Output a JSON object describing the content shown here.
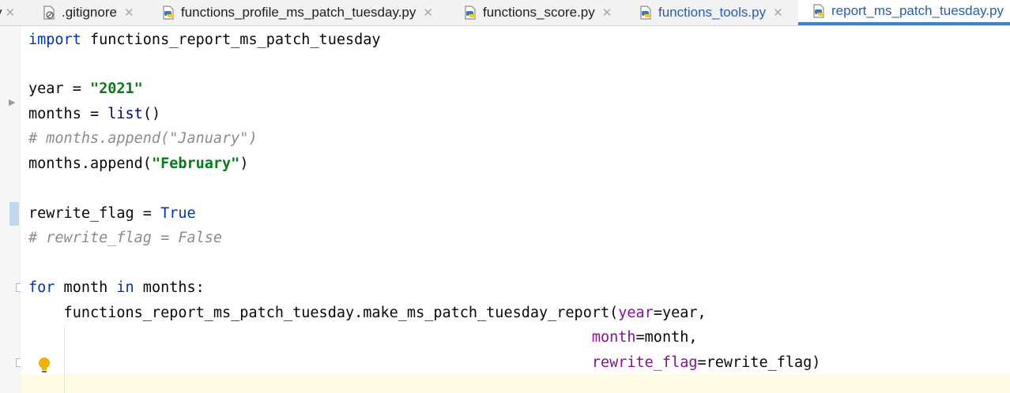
{
  "tabs": [
    {
      "label": "",
      "close": "✕",
      "icon": "python-file-icon"
    },
    {
      "label": ".gitignore",
      "close": "✕",
      "icon": "ignored-file-icon"
    },
    {
      "label": "functions_profile_ms_patch_tuesday.py",
      "close": "✕",
      "icon": "python-file-icon"
    },
    {
      "label": "functions_score.py",
      "close": "✕",
      "icon": "python-file-icon"
    },
    {
      "label": "functions_tools.py",
      "close": "✕",
      "icon": "python-file-icon"
    },
    {
      "label": "report_ms_patch_tuesday.py",
      "close": "",
      "icon": "python-file-icon",
      "active": true
    }
  ],
  "tab_first_partial": "y",
  "code": {
    "l1_kw": "import",
    "l1_rest": " functions_report_ms_patch_tuesday",
    "l3_a": "year = ",
    "l3_str": "\"2021\"",
    "l4_a": "months = ",
    "l4_fn": "list",
    "l4_b": "()",
    "l5_cmt": "# months.append(\"January\")",
    "l6_a": "months.append(",
    "l6_str": "\"February\"",
    "l6_b": ")",
    "l8_a": "rewrite_flag = ",
    "l8_kw": "True",
    "l9_cmt": "# rewrite_flag = False",
    "l11_kw1": "for",
    "l11_a": " month ",
    "l11_kw2": "in",
    "l11_b": " months:",
    "l12_a": "    functions_report_ms_patch_tuesday.make_ms_patch_tuesday_report(",
    "l12_param": "year",
    "l12_b": "=year,",
    "l13_pad": "                                                                ",
    "l13_param": "month",
    "l13_b": "=month,",
    "l14_pad": "                                                                ",
    "l14_param": "rewrite_flag",
    "l14_b": "=rewrite_flag)"
  },
  "colors": {
    "keyword": "#0033b3",
    "string": "#067d17",
    "comment": "#8c8c8c",
    "param": "#871094",
    "active_tab_underline": "#4083c9"
  }
}
